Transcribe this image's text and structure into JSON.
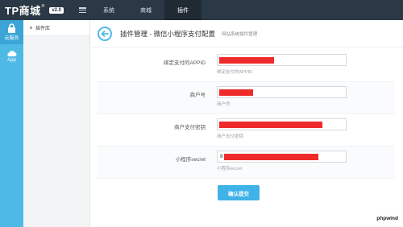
{
  "app": {
    "logo": "TP商城",
    "logo_reg": "®",
    "version": "v2.0"
  },
  "nav": {
    "tabs": [
      {
        "label": "系统"
      },
      {
        "label": "商城"
      },
      {
        "label": "插件"
      }
    ]
  },
  "leftbar": {
    "items": [
      {
        "label": "云服务",
        "icon": "lock-icon"
      },
      {
        "label": "App",
        "icon": "cloud-icon"
      }
    ]
  },
  "subnav": {
    "items": [
      {
        "label": "插件库"
      }
    ]
  },
  "header": {
    "title": "插件管理 - 微信小程序支付配置",
    "subtitle": "网站系统插件管理"
  },
  "form": {
    "fields": [
      {
        "label": "绑定支付的APPID",
        "value": "",
        "help": "绑定支付的APPID"
      },
      {
        "label": "商户号",
        "value": "",
        "help": "商户号"
      },
      {
        "label": "商户支付密钥",
        "value": "",
        "help": "商户支付密钥"
      },
      {
        "label": "小程序secret",
        "value": "8",
        "help": "小程序secret"
      }
    ],
    "submit_label": "确认提交"
  },
  "watermark": "phpwind",
  "colors": {
    "topbar": "#2b3845",
    "accent": "#4fb9e6",
    "button": "#3fb3e8",
    "redaction": "#ee2a2a"
  }
}
